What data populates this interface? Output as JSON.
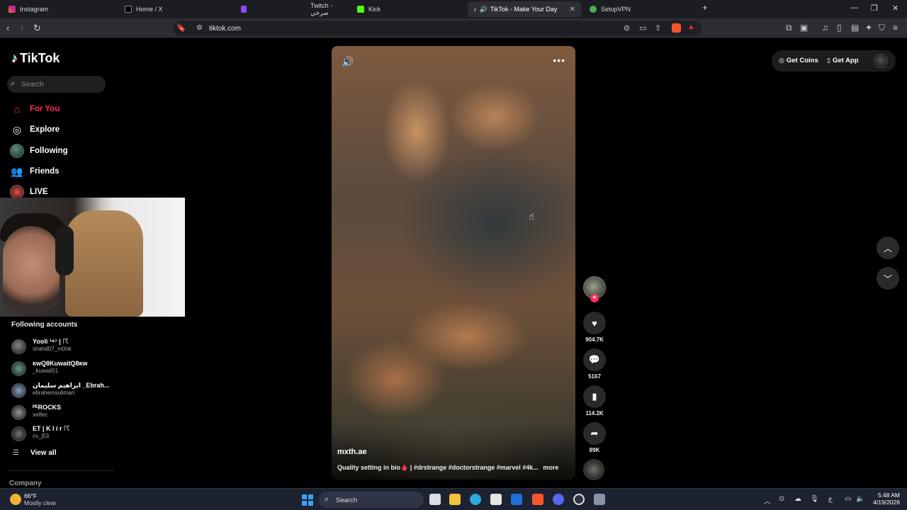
{
  "browser": {
    "tabs": [
      {
        "label": "Instagram",
        "icon": "instagram-icon",
        "color": "#e1306c"
      },
      {
        "label": "Home / X",
        "icon": "x-icon",
        "color": "#ffffff"
      },
      {
        "label": "Twitch - صرخي",
        "icon": "twitch-icon",
        "color": "#9146ff"
      },
      {
        "label": "Kick",
        "icon": "kick-icon",
        "color": "#53fc18"
      },
      {
        "label": "TikTok - Make Your Day",
        "icon": "tiktok-icon",
        "color": "#ffffff",
        "active": true
      },
      {
        "label": "SetupVPN",
        "icon": "setupvpn-icon",
        "color": "#4caf50"
      }
    ],
    "new_tab": "+",
    "url": "tiktok.com"
  },
  "sidebar": {
    "logo": "TikTok",
    "search_placeholder": "Search",
    "nav": [
      {
        "label": "For You",
        "icon": "home-icon",
        "active": true
      },
      {
        "label": "Explore",
        "icon": "compass-icon"
      },
      {
        "label": "Following",
        "icon": "following-avatar"
      },
      {
        "label": "Friends",
        "icon": "friends-icon"
      },
      {
        "label": "LIVE",
        "icon": "live-icon"
      }
    ],
    "following_title": "Following accounts",
    "accounts": [
      {
        "name": "Yooli ¹⁸⁷ | ☈",
        "handle": "shahd07_m0nk"
      },
      {
        "name": "ĸwQ8KuwaitQ8ĸw",
        "handle": "_kuwait51"
      },
      {
        "name": "ابراهيم سليمان _Ebrah...",
        "handle": "ebrahemsuliman"
      },
      {
        "name": "ᴾᴱROCKS",
        "handle": "xe8ec"
      },
      {
        "name": "ET | K l i r ☈",
        "handle": "cv_j53"
      }
    ],
    "view_all": "View all",
    "company": "Company"
  },
  "video": {
    "author": "mxth.ae",
    "caption": "Quality setting in bio🩸 | #drstrange #doctorstrange #marvel #4k...",
    "more": "more",
    "likes": "904.7K",
    "comments": "5167",
    "saves": "114.2K",
    "shares": "89K"
  },
  "header": {
    "get_coins": "Get Coins",
    "get_app": "Get App"
  },
  "taskbar": {
    "temp": "66°F",
    "weather": "Mostly clear",
    "search": "Search",
    "time": "5:48 AM",
    "date": "4/19/2026",
    "lang": "ع"
  },
  "colors": {
    "accent": "#fe2c55",
    "background": "#000000"
  }
}
